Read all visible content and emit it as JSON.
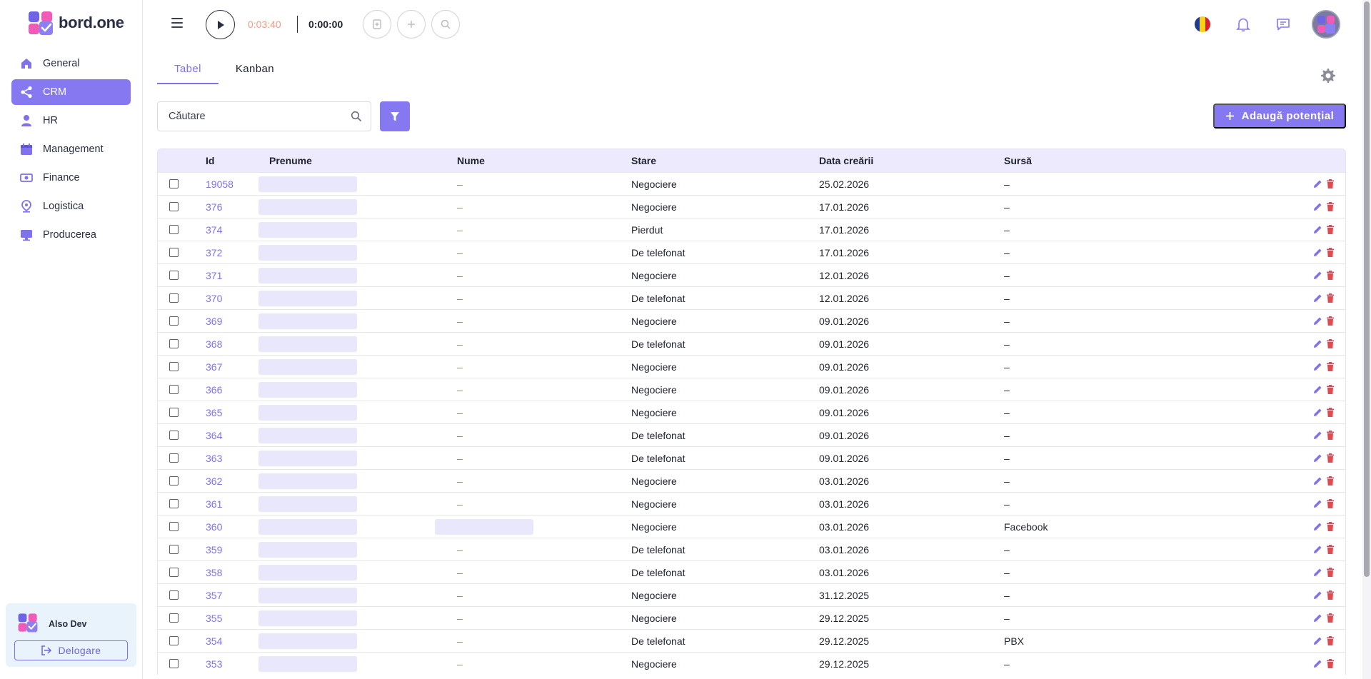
{
  "brand": {
    "name": "bord.one"
  },
  "sidebar": {
    "items": [
      {
        "label": "General",
        "icon": "home-icon",
        "active": false
      },
      {
        "label": "CRM",
        "icon": "share-icon",
        "active": true
      },
      {
        "label": "HR",
        "icon": "person-icon",
        "active": false
      },
      {
        "label": "Management",
        "icon": "calendar-icon",
        "active": false
      },
      {
        "label": "Finance",
        "icon": "money-icon",
        "active": false
      },
      {
        "label": "Logistica",
        "icon": "location-icon",
        "active": false
      },
      {
        "label": "Producerea",
        "icon": "monitor-icon",
        "active": false
      }
    ],
    "user": {
      "name": "Also Dev",
      "logout_label": "Delogare"
    }
  },
  "topbar": {
    "timer_elapsed": "0:03:40",
    "timer_total": "0:00:00"
  },
  "tabs": [
    {
      "label": "Tabel",
      "active": true
    },
    {
      "label": "Kanban",
      "active": false
    }
  ],
  "toolbar": {
    "search_placeholder": "Căutare",
    "add_label": "Adaugă potențial"
  },
  "table": {
    "headers": {
      "id": "Id",
      "prenume": "Prenume",
      "nume": "Nume",
      "stare": "Stare",
      "data": "Data creării",
      "sursa": "Sursă"
    },
    "rows": [
      {
        "id": "19058",
        "nume": "–",
        "stare": "Negociere",
        "data": "25.02.2026",
        "sursa": "–"
      },
      {
        "id": "376",
        "nume": "–",
        "stare": "Negociere",
        "data": "17.01.2026",
        "sursa": "–"
      },
      {
        "id": "374",
        "nume": "–",
        "stare": "Pierdut",
        "data": "17.01.2026",
        "sursa": "–"
      },
      {
        "id": "372",
        "nume": "–",
        "stare": "De telefonat",
        "data": "17.01.2026",
        "sursa": "–"
      },
      {
        "id": "371",
        "nume": "–",
        "stare": "Negociere",
        "data": "12.01.2026",
        "sursa": "–"
      },
      {
        "id": "370",
        "nume": "–",
        "stare": "De telefonat",
        "data": "12.01.2026",
        "sursa": "–"
      },
      {
        "id": "369",
        "nume": "–",
        "stare": "Negociere",
        "data": "09.01.2026",
        "sursa": "–"
      },
      {
        "id": "368",
        "nume": "–",
        "stare": "De telefonat",
        "data": "09.01.2026",
        "sursa": "–"
      },
      {
        "id": "367",
        "nume": "–",
        "stare": "Negociere",
        "data": "09.01.2026",
        "sursa": "–"
      },
      {
        "id": "366",
        "nume": "–",
        "stare": "Negociere",
        "data": "09.01.2026",
        "sursa": "–"
      },
      {
        "id": "365",
        "nume": "–",
        "stare": "Negociere",
        "data": "09.01.2026",
        "sursa": "–"
      },
      {
        "id": "364",
        "nume": "–",
        "stare": "De telefonat",
        "data": "09.01.2026",
        "sursa": "–"
      },
      {
        "id": "363",
        "nume": "–",
        "stare": "De telefonat",
        "data": "09.01.2026",
        "sursa": "–"
      },
      {
        "id": "362",
        "nume": "–",
        "stare": "Negociere",
        "data": "03.01.2026",
        "sursa": "–"
      },
      {
        "id": "361",
        "nume": "–",
        "stare": "Negociere",
        "data": "03.01.2026",
        "sursa": "–"
      },
      {
        "id": "360",
        "nume": "",
        "stare": "Negociere",
        "data": "03.01.2026",
        "sursa": "Facebook"
      },
      {
        "id": "359",
        "nume": "–",
        "stare": "De telefonat",
        "data": "03.01.2026",
        "sursa": "–"
      },
      {
        "id": "358",
        "nume": "–",
        "stare": "De telefonat",
        "data": "03.01.2026",
        "sursa": "–"
      },
      {
        "id": "357",
        "nume": "–",
        "stare": "Negociere",
        "data": "31.12.2025",
        "sursa": "–"
      },
      {
        "id": "355",
        "nume": "–",
        "stare": "Negociere",
        "data": "29.12.2025",
        "sursa": "–"
      },
      {
        "id": "354",
        "nume": "–",
        "stare": "De telefonat",
        "data": "29.12.2025",
        "sursa": "PBX"
      },
      {
        "id": "353",
        "nume": "–",
        "stare": "Negociere",
        "data": "29.12.2025",
        "sursa": "–"
      }
    ]
  },
  "colors": {
    "accent": "#8578f0",
    "link": "#7f72ea",
    "timer_elapsed": "#f29a88",
    "delete": "#e5484d",
    "header_bg": "#eceafc",
    "blurred_cell": "#e9e7fb"
  }
}
